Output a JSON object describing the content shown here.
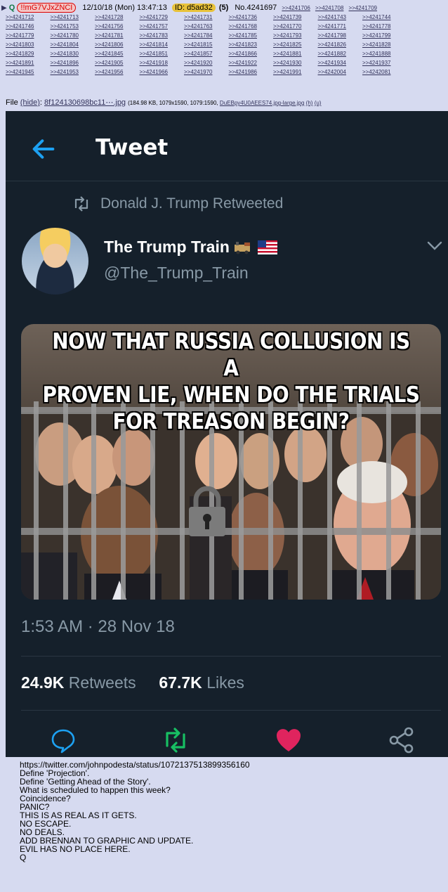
{
  "post": {
    "q_label": "Q",
    "tripcode": "!!mG7VJxZNCI",
    "datetime": "12/10/18 (Mon) 13:47:13",
    "id": "ID: d5ad32",
    "id_count": "(5)",
    "post_number": "No.4241697",
    "header_replies": [
      ">>4241706",
      ">>4241708",
      ">>4241709"
    ],
    "replies": [
      ">>4241712",
      ">>4241713",
      ">>4241728",
      ">>4241729",
      ">>4241731",
      ">>4241736",
      ">>4241739",
      ">>4241743",
      ">>4241744",
      ">>4241746",
      ">>4241753",
      ">>4241756",
      ">>4241757",
      ">>4241763",
      ">>4241768",
      ">>4241770",
      ">>4241771",
      ">>4241778",
      ">>4241779",
      ">>4241780",
      ">>4241781",
      ">>4241783",
      ">>4241784",
      ">>4241785",
      ">>4241793",
      ">>4241798",
      ">>4241799",
      ">>4241803",
      ">>4241804",
      ">>4241806",
      ">>4241814",
      ">>4241815",
      ">>4241823",
      ">>4241825",
      ">>4241826",
      ">>4241828",
      ">>4241829",
      ">>4241830",
      ">>4241845",
      ">>4241851",
      ">>4241857",
      ">>4241866",
      ">>4241881",
      ">>4241882",
      ">>4241888",
      ">>4241891",
      ">>4241896",
      ">>4241905",
      ">>4241918",
      ">>4241920",
      ">>4241922",
      ">>4241930",
      ">>4241934",
      ">>4241937",
      ">>4241945",
      ">>4241953",
      ">>4241956",
      ">>4241966",
      ">>4241970",
      ">>4241986",
      ">>4241991",
      ">>4242004",
      ">>4242081"
    ],
    "file": {
      "label": "File",
      "hide": "(hide)",
      "name": "8f124130698bc11⋯.jpg",
      "meta": "(184.98 KB, 1079x1590, 1079:1590,",
      "original_name": "DuEBpy4U0AEES74.jpg-large.jpg",
      "h": "(h)",
      "u": "(u)"
    },
    "body": "https://twitter.com/johnpodesta/status/1072137513899356160\nDefine 'Projection'.\nDefine 'Getting Ahead of the Story'.\nWhat is scheduled to happen this week?\nCoincidence?\nPANIC?\nTHIS IS AS REAL AS IT GETS.\nNO ESCAPE.\nNO DEALS.\nADD BRENNAN TO GRAPHIC AND UPDATE.\nEVIL HAS NO PLACE HERE.\nQ"
  },
  "tweet": {
    "title": "Tweet",
    "retweeted_by": "Donald J. Trump Retweeted",
    "display_name": "The Trump Train",
    "handle": "@The_Trump_Train",
    "meme_caption_lines": [
      "NOW THAT RUSSIA COLLUSION IS A",
      "PROVEN LIE, WHEN DO THE TRIALS",
      "FOR TREASON BEGIN?"
    ],
    "timestamp": "1:53 AM · 28 Nov 18",
    "retweet_count": "24.9K",
    "retweet_label": "Retweets",
    "like_count": "67.7K",
    "like_label": "Likes",
    "icons": [
      "back-arrow-icon",
      "retweet-icon",
      "train-emoji-icon",
      "us-flag-icon",
      "chevron-down-icon",
      "reply-icon",
      "retweet-icon",
      "heart-icon",
      "share-icon"
    ]
  },
  "colors": {
    "board_bg": "#d6daf0",
    "link": "#34345c",
    "q_green": "#117743",
    "tweet_bg": "#15202b",
    "twitter_blue": "#1da1f2",
    "retweet_green": "#17bf63",
    "like_pink": "#e0245e",
    "muted": "#8899a6"
  }
}
